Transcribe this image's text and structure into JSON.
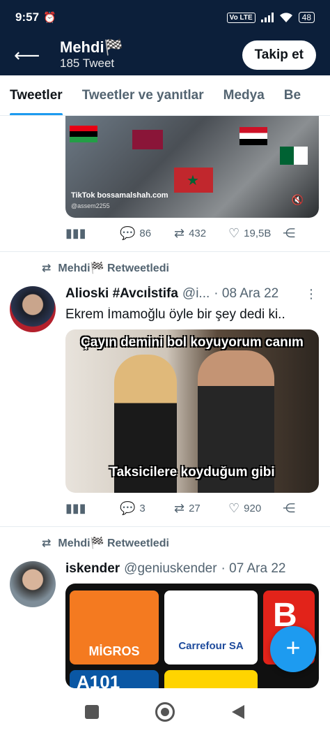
{
  "status_bar": {
    "time": "9:57",
    "alarm_icon": "alarm-icon",
    "network": "Vo LTE",
    "wifi_icon": "wifi-icon",
    "battery": "48"
  },
  "header": {
    "back_icon": "arrow-left-icon",
    "name": "Mehdi🏁",
    "tweet_count": "185 Tweet",
    "follow_label": "Takip et"
  },
  "tabs": [
    {
      "label": "Tweetler",
      "active": true
    },
    {
      "label": "Tweetler ve yanıtlar",
      "active": false
    },
    {
      "label": "Medya",
      "active": false
    },
    {
      "label": "Be",
      "active": false
    }
  ],
  "tweets": [
    {
      "media_caption": "TikTok bossamalshah.com",
      "media_handle": "@assem2255",
      "actions": {
        "views": "",
        "replies": "86",
        "retweets": "432",
        "likes": "19,5B"
      }
    },
    {
      "retweet_label": "Mehdi🏁 Retweetledi",
      "author": "Alioski #Avcıİstifa",
      "handle": "@i...",
      "date": "· 08 Ara 22",
      "text": "Ekrem İmamoğlu öyle bir şey dedi ki..",
      "media_caption_top": "Çayın demini bol koyuyorum canım",
      "media_caption_bottom": "Taksicilere koyduğum gibi",
      "actions": {
        "views": "",
        "replies": "3",
        "retweets": "27",
        "likes": "920"
      }
    },
    {
      "retweet_label": "Mehdi🏁 Retweetledi",
      "author": "iskender",
      "handle": "@geniuskender",
      "date": "· 07 Ara 22",
      "logos": [
        "MİGROS",
        "Carrefour SA",
        "B",
        "A101"
      ]
    }
  ],
  "fab_label": "+",
  "colors": {
    "header_bg": "#0c1f3a",
    "accent": "#1d9bf0",
    "muted": "#536471"
  }
}
